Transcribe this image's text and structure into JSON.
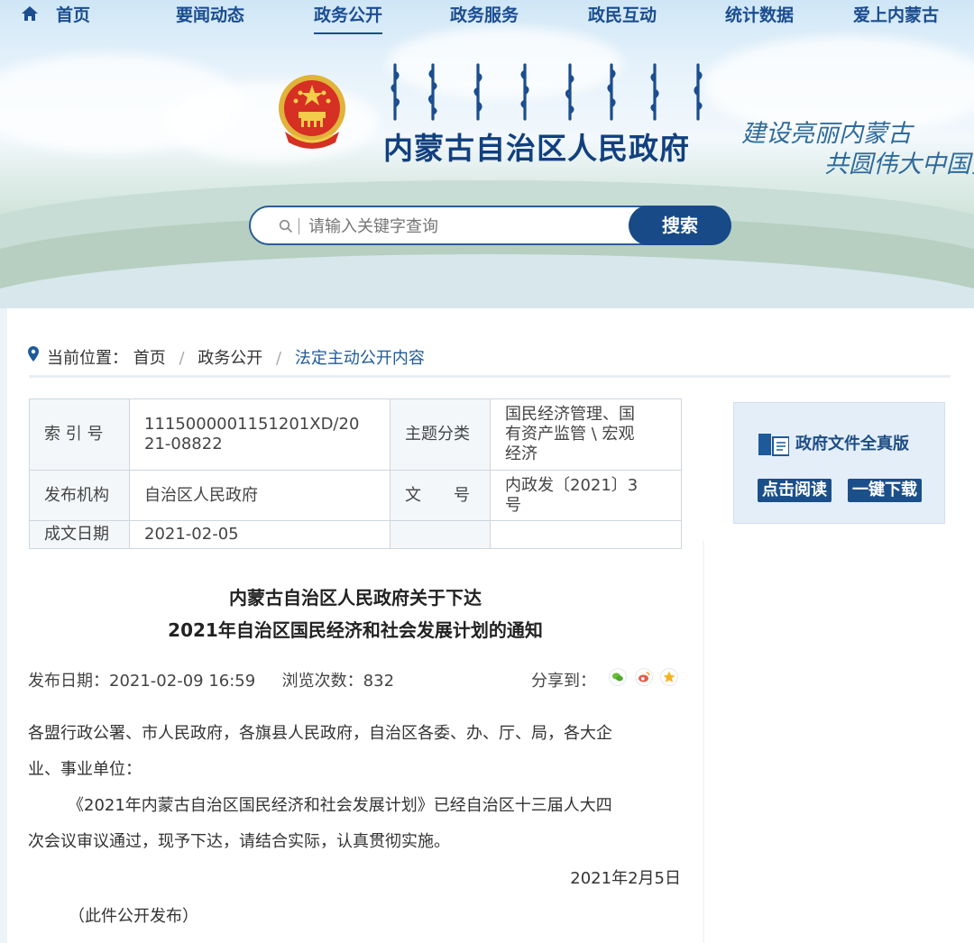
{
  "nav": {
    "items": [
      "首页",
      "要闻动态",
      "政务公开",
      "政务服务",
      "政民互动",
      "统计数据",
      "爱上内蒙古"
    ],
    "active": "政务公开"
  },
  "header": {
    "site_title": "内蒙古自治区人民政府",
    "slogan_line1": "建设亮丽内蒙古",
    "slogan_line2": "共圆伟大中国梦"
  },
  "search": {
    "placeholder": "请输入关键字查询",
    "button_label": "搜索"
  },
  "breadcrumb": {
    "prefix": "当前位置：",
    "items": [
      "首页",
      "政务公开",
      "法定主动公开内容"
    ]
  },
  "meta_table": {
    "index_label": "索 引 号",
    "index_value_line1": "1115000001151201XD/20",
    "index_value_line2": "21-08822",
    "topic_label": "主题分类",
    "topic_value_line1": "国民经济管理、国",
    "topic_value_line2": "有资产监管 \\ 宏观",
    "topic_value_line3": "经济",
    "issuer_label": "发布机构",
    "issuer_value": "自治区人民政府",
    "docno_label": "文　　号",
    "docno_value_line1": "内政发〔2021〕3",
    "docno_value_line2": "号",
    "date_label": "成文日期",
    "date_value": "2021-02-05"
  },
  "doc_card": {
    "title": "政府文件全真版",
    "read_button": "点击阅读",
    "download_button": "一键下载"
  },
  "article": {
    "title_line1": "内蒙古自治区人民政府关于下达",
    "title_line2": "2021年自治区国民经济和社会发展计划的通知",
    "publish_date": "发布日期：2021-02-09 16:59",
    "views": "浏览次数：832",
    "share_label": "分享到：",
    "para1_line1": "各盟行政公署、市人民政府，各旗县人民政府，自治区各委、办、厅、局，各大企",
    "para1_line2": "业、事业单位：",
    "para2_line1": "《2021年内蒙古自治区国民经济和社会发展计划》已经自治区十三届人大四",
    "para2_line2": "次会议审议通过，现予下达，请结合实际，认真贯彻实施。",
    "sign_date": "2021年2月5日",
    "note": "（此件公开发布）"
  },
  "colors": {
    "brand_blue": "#174a86",
    "nav_text": "#1b4d8f",
    "breadcrumb_current": "#1d5a9a"
  }
}
